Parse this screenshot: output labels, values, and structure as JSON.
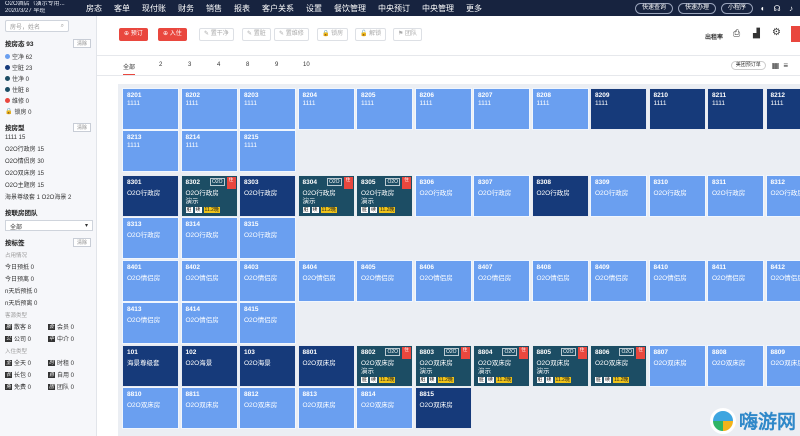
{
  "nav": {
    "hotel_line1": "O2O酒店（演示专用...",
    "hotel_line2": "2020/3/27 早班",
    "items": [
      "房态",
      "客单",
      "现付账",
      "财务",
      "销售",
      "报表",
      "客户关系",
      "设置",
      "餐饮管理",
      "中央预订",
      "中央管理",
      "更多"
    ],
    "quick_search": "快速查询",
    "quick_handle": "快速办理",
    "mini_program": "小程序"
  },
  "sidebar": {
    "search_placeholder": "房号，姓名",
    "status_title": "按房态 93",
    "status": [
      {
        "label": "空净 62",
        "color": "#6a9ff0"
      },
      {
        "label": "空脏 23",
        "color": "#163a7a"
      },
      {
        "label": "住净 0",
        "color": "#1c4d64"
      },
      {
        "label": "住脏 8",
        "color": "#1c4d64"
      },
      {
        "label": "维修 0",
        "color": "#e9473e"
      },
      {
        "label": "锁房 0",
        "color": "#888888"
      }
    ],
    "type_title": "按房型",
    "types": [
      "1111 15",
      "O2O行政房 15",
      "O2O情侣房 30",
      "O2O双床房 15",
      "O2O主题房 15",
      "海景尊级套 1  O2O海景 2"
    ],
    "team_title": "按联房团队",
    "team_value": "全部",
    "mark_title": "按标签",
    "occupancy_label": "占用情况",
    "occupancy": [
      "今日预抵 0",
      "今日预离 0",
      "n天后预抵 0",
      "n天后预离 0"
    ],
    "guest_label": "客源类型",
    "guests": [
      {
        "tag": "散",
        "label": "散客 8"
      },
      {
        "tag": "会",
        "label": "会员 0"
      },
      {
        "tag": "公",
        "label": "公司 0"
      },
      {
        "tag": "中",
        "label": "中介 0"
      }
    ],
    "checkin_label": "入住类型",
    "checkins": [
      {
        "tag": "全",
        "label": "全天 0"
      },
      {
        "tag": "时",
        "label": "时租 0"
      },
      {
        "tag": "长",
        "label": "长包 0"
      },
      {
        "tag": "自",
        "label": "自用 0"
      },
      {
        "tag": "免",
        "label": "免费 0"
      },
      {
        "tag": "团",
        "label": "团队 0"
      }
    ],
    "clear_label": "清除"
  },
  "toolbar": {
    "book": "预订",
    "checkin": "入住",
    "buttons": [
      "置干净",
      "置脏",
      "置维修",
      "锁房",
      "解锁",
      "团队"
    ],
    "checkout_label": "出租率"
  },
  "tabs": {
    "items": [
      "全部",
      "2",
      "3",
      "4",
      "8",
      "9",
      "10"
    ],
    "right_label": "美团预订单"
  },
  "rooms": [
    {
      "no": "8201",
      "type": "1111",
      "s": "light"
    },
    {
      "no": "8202",
      "type": "1111",
      "s": "light"
    },
    {
      "no": "8203",
      "type": "1111",
      "s": "light"
    },
    {
      "no": "8204",
      "type": "1111",
      "s": "light"
    },
    {
      "no": "8205",
      "type": "1111",
      "s": "light"
    },
    {
      "no": "8206",
      "type": "1111",
      "s": "light"
    },
    {
      "no": "8207",
      "type": "1111",
      "s": "light"
    },
    {
      "no": "8208",
      "type": "1111",
      "s": "light"
    },
    {
      "no": "8209",
      "type": "1111",
      "s": "dark"
    },
    {
      "no": "8210",
      "type": "1111",
      "s": "dark"
    },
    {
      "no": "8211",
      "type": "1111",
      "s": "dark"
    },
    {
      "no": "8212",
      "type": "1111",
      "s": "dark"
    },
    {
      "no": "8213",
      "type": "1111",
      "s": "light"
    },
    {
      "no": "8214",
      "type": "1111",
      "s": "light"
    },
    {
      "no": "8215",
      "type": "1111",
      "s": "light"
    },
    {
      "no": "8301",
      "type": "O2O行政房",
      "s": "dark"
    },
    {
      "no": "8302",
      "type": "O2O行政房",
      "guest": "演示",
      "s": "teal",
      "occ": true
    },
    {
      "no": "8303",
      "type": "O2O行政房",
      "s": "dark"
    },
    {
      "no": "8304",
      "type": "O2O行政房",
      "guest": "演示",
      "s": "teal",
      "occ": true
    },
    {
      "no": "8305",
      "type": "O2O行政房",
      "guest": "演示",
      "s": "teal",
      "occ": true
    },
    {
      "no": "8306",
      "type": "O2O行政房",
      "s": "light"
    },
    {
      "no": "8307",
      "type": "O2O行政房",
      "s": "light"
    },
    {
      "no": "8308",
      "type": "O2O行政房",
      "s": "dark"
    },
    {
      "no": "8309",
      "type": "O2O行政房",
      "s": "light"
    },
    {
      "no": "8310",
      "type": "O2O行政房",
      "s": "light"
    },
    {
      "no": "8311",
      "type": "O2O行政房",
      "s": "light"
    },
    {
      "no": "8312",
      "type": "O2O行政房",
      "s": "light"
    },
    {
      "no": "8313",
      "type": "O2O行政房",
      "s": "light"
    },
    {
      "no": "8314",
      "type": "O2O行政房",
      "s": "light"
    },
    {
      "no": "8315",
      "type": "O2O行政房",
      "s": "light"
    },
    {
      "no": "8401",
      "type": "O2O情侣房",
      "s": "light"
    },
    {
      "no": "8402",
      "type": "O2O情侣房",
      "s": "light"
    },
    {
      "no": "8403",
      "type": "O2O情侣房",
      "s": "light"
    },
    {
      "no": "8404",
      "type": "O2O情侣房",
      "s": "light"
    },
    {
      "no": "8405",
      "type": "O2O情侣房",
      "s": "light"
    },
    {
      "no": "8406",
      "type": "O2O情侣房",
      "s": "light"
    },
    {
      "no": "8407",
      "type": "O2O情侣房",
      "s": "light"
    },
    {
      "no": "8408",
      "type": "O2O情侣房",
      "s": "light"
    },
    {
      "no": "8409",
      "type": "O2O情侣房",
      "s": "light"
    },
    {
      "no": "8410",
      "type": "O2O情侣房",
      "s": "light"
    },
    {
      "no": "8411",
      "type": "O2O情侣房",
      "s": "light"
    },
    {
      "no": "8412",
      "type": "O2O情侣房",
      "s": "light"
    },
    {
      "no": "8413",
      "type": "O2O情侣房",
      "s": "light"
    },
    {
      "no": "8414",
      "type": "O2O情侣房",
      "s": "light"
    },
    {
      "no": "8415",
      "type": "O2O情侣房",
      "s": "light"
    },
    {
      "no": "101",
      "type": "海景尊级套",
      "s": "dark"
    },
    {
      "no": "102",
      "type": "O2O海景",
      "s": "dark"
    },
    {
      "no": "103",
      "type": "O2O海景",
      "s": "dark"
    },
    {
      "no": "8801",
      "type": "O2O双床房",
      "s": "dark"
    },
    {
      "no": "8802",
      "type": "O2O双床房",
      "guest": "演示",
      "s": "teal",
      "occ": true
    },
    {
      "no": "8803",
      "type": "O2O双床房",
      "guest": "演示",
      "s": "teal",
      "occ": true
    },
    {
      "no": "8804",
      "type": "O2O双床房",
      "guest": "演示",
      "s": "teal",
      "occ": true
    },
    {
      "no": "8805",
      "type": "O2O双床房",
      "guest": "演示",
      "s": "teal",
      "occ": true
    },
    {
      "no": "8806",
      "type": "O2O双床房",
      "s": "teal",
      "occ": true
    },
    {
      "no": "8807",
      "type": "O2O双床房",
      "s": "light"
    },
    {
      "no": "8808",
      "type": "O2O双床房",
      "s": "light"
    },
    {
      "no": "8809",
      "type": "O2O双床房",
      "s": "light"
    },
    {
      "no": "8810",
      "type": "O2O双床房",
      "s": "light"
    },
    {
      "no": "8811",
      "type": "O2O双床房",
      "s": "light"
    },
    {
      "no": "8812",
      "type": "O2O双床房",
      "s": "light"
    },
    {
      "no": "8813",
      "type": "O2O双床房",
      "s": "light"
    },
    {
      "no": "8814",
      "type": "O2O双床房",
      "s": "light"
    },
    {
      "no": "8815",
      "type": "O2O双床房",
      "s": "dark"
    }
  ],
  "room_badges": {
    "corner": "O2O",
    "tag_dirty": "脏",
    "tag_continue": "续",
    "tag_flag": "住",
    "tag_time": "11.2晚"
  },
  "watermark": "嗨游网"
}
